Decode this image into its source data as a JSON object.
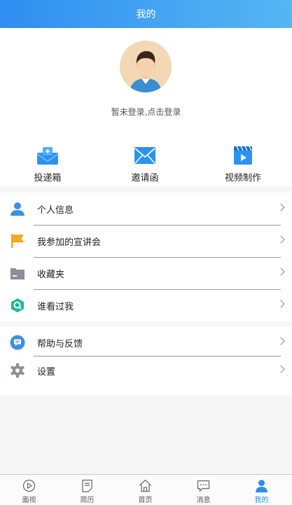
{
  "header": {
    "title": "我的"
  },
  "profile": {
    "login_hint": "暂未登录,点击登录",
    "avatar_icon": "user-avatar"
  },
  "quick_actions": [
    {
      "label": "投递箱",
      "icon": "outbox-icon"
    },
    {
      "label": "邀请函",
      "icon": "envelope-icon"
    },
    {
      "label": "视频制作",
      "icon": "video-icon"
    }
  ],
  "menu_group1": [
    {
      "label": "个人信息",
      "icon": "person-icon"
    },
    {
      "label": "我参加的宣讲会",
      "icon": "flag-icon"
    },
    {
      "label": "收藏夹",
      "icon": "folder-icon"
    },
    {
      "label": "谁看过我",
      "icon": "visitor-icon"
    }
  ],
  "menu_group2": [
    {
      "label": "帮助与反馈",
      "icon": "chat-icon"
    },
    {
      "label": "设置",
      "icon": "gear-icon"
    }
  ],
  "tabs": [
    {
      "label": "面视",
      "icon": "play-circle-icon",
      "active": false
    },
    {
      "label": "简历",
      "icon": "resume-icon",
      "active": false
    },
    {
      "label": "首页",
      "icon": "home-icon",
      "active": false
    },
    {
      "label": "消息",
      "icon": "message-icon",
      "active": false
    },
    {
      "label": "我的",
      "icon": "person-icon",
      "active": true
    }
  ],
  "colors": {
    "accent": "#2b8ff0",
    "header_start": "#2f8ef0",
    "header_end": "#56b6f3",
    "flag": "#f5a623",
    "visitor": "#1fb89a",
    "gray_icon": "#8a8f99"
  }
}
